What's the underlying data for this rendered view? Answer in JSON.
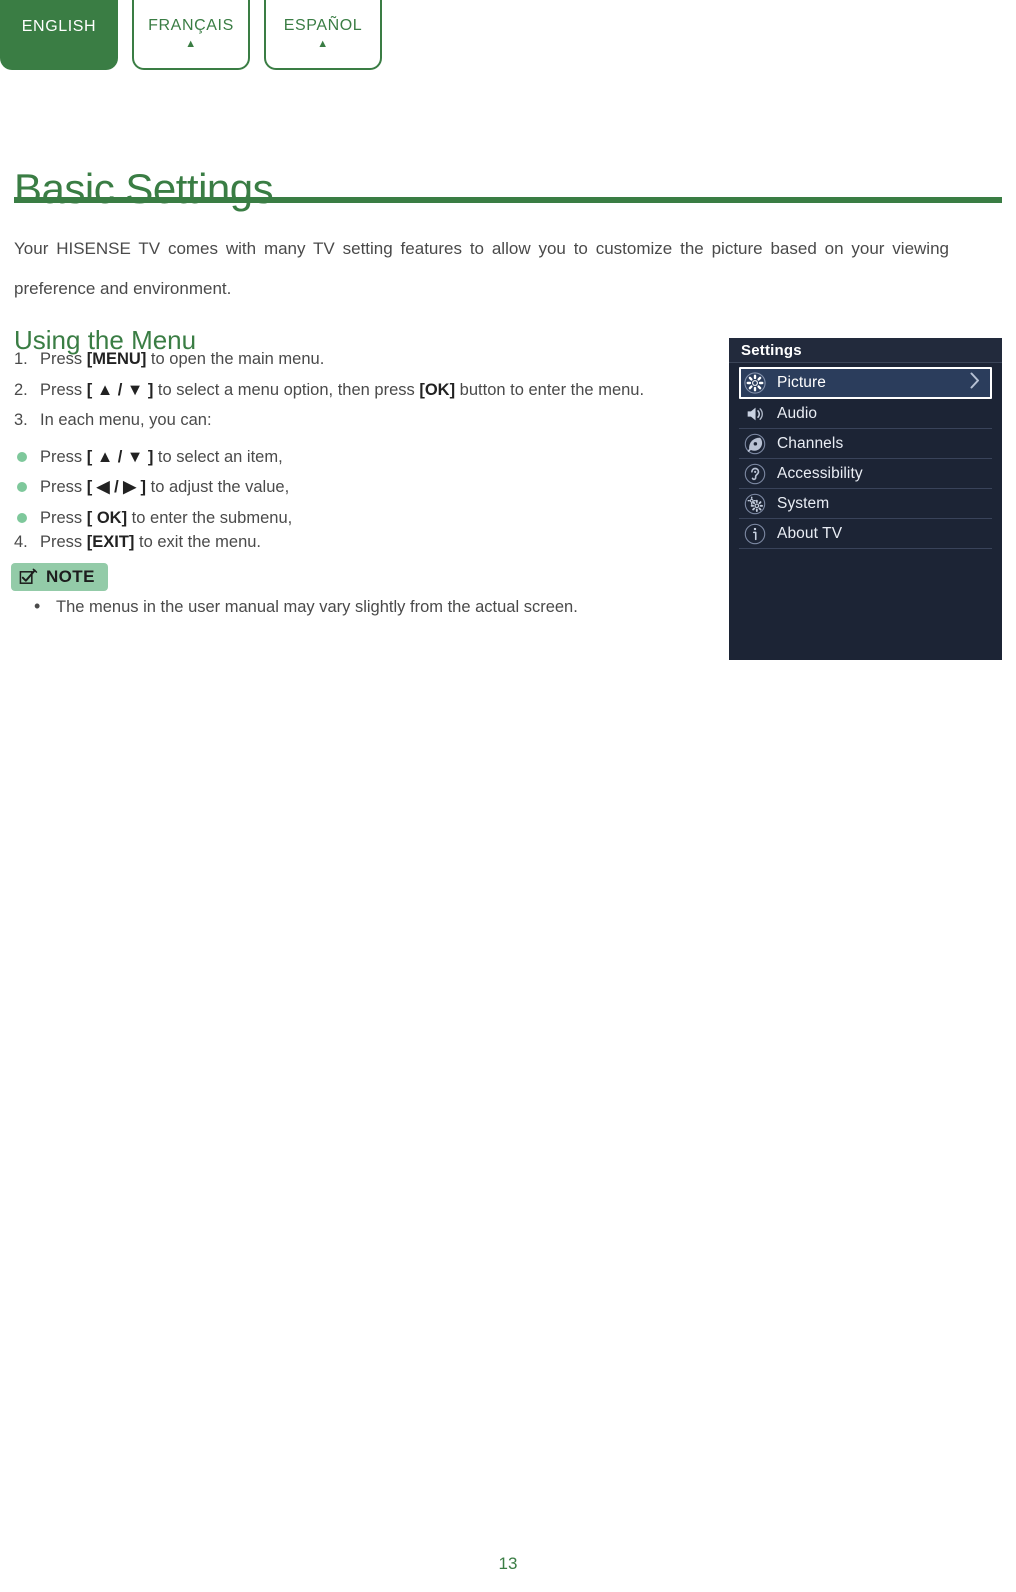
{
  "language_tabs": [
    {
      "label": "ENGLISH",
      "active": true,
      "caret": "▲"
    },
    {
      "label": "FRANÇAIS",
      "active": false,
      "caret": "▲"
    },
    {
      "label": "ESPAÑOL",
      "active": false,
      "caret": "▲"
    }
  ],
  "page": {
    "title": "Basic Settings",
    "intro": "Your HISENSE TV comes with many TV setting features to allow you to customize the picture based on your viewing preference and environment.",
    "section_heading": "Using the Menu",
    "page_number": "13",
    "accent_color": "#3a7d44",
    "bullet_color": "#7ec89b"
  },
  "steps": [
    {
      "marker": "1.",
      "type": "number",
      "pre": "Press ",
      "bold": "[MENU]",
      "post": " to open the main menu."
    },
    {
      "marker": "2.",
      "type": "number",
      "pre": "Press ",
      "bold": "[ ▲ / ▼ ]",
      "post": " to select a menu option, then press ",
      "bold2": "[OK]",
      "post2": " button to enter the menu."
    },
    {
      "marker": "3.",
      "type": "number",
      "pre": "In each menu, you can:",
      "bold": "",
      "post": ""
    },
    {
      "marker": "●",
      "type": "bullet",
      "pre": "Press ",
      "bold": "[ ▲ / ▼ ]",
      "post": " to select an item,"
    },
    {
      "marker": "●",
      "type": "bullet",
      "pre": "Press ",
      "bold": "[ ◀ / ▶ ]",
      "post": " to adjust the value,"
    },
    {
      "marker": "●",
      "type": "bullet",
      "pre": "Press ",
      "bold": "[ OK]",
      "post": " to enter the submenu,"
    },
    {
      "marker": "4.",
      "type": "number",
      "pre": "Press ",
      "bold": "[EXIT]",
      "post": " to exit the menu."
    }
  ],
  "note": {
    "badge_label": "NOTE",
    "badge_bg": "#93cba8",
    "icon": "checkbox-pencil-icon",
    "items": [
      {
        "bullet": "•",
        "text": "The menus in the user manual may vary slightly from the actual screen."
      }
    ]
  },
  "tv_menu": {
    "title": "Settings",
    "background": "#1c2435",
    "selected_background": "#2b3d5c",
    "items": [
      {
        "label": "Picture",
        "icon": "gear-icon",
        "selected": true,
        "chevron": "›"
      },
      {
        "label": "Audio",
        "icon": "speaker-icon",
        "selected": false,
        "chevron": ""
      },
      {
        "label": "Channels",
        "icon": "satellite-dish-icon",
        "selected": false,
        "chevron": ""
      },
      {
        "label": "Accessibility",
        "icon": "ear-icon",
        "selected": false,
        "chevron": ""
      },
      {
        "label": "System",
        "icon": "gears-icon",
        "selected": false,
        "chevron": ""
      },
      {
        "label": "About TV",
        "icon": "info-icon",
        "selected": false,
        "chevron": ""
      }
    ]
  }
}
